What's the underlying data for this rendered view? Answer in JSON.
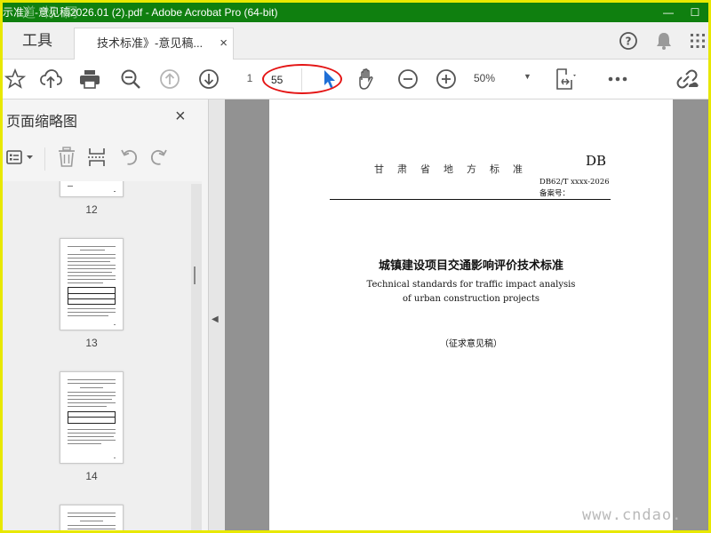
{
  "window": {
    "title": "示准》-意见稿2026.01 (2).pdf - Adobe Acrobat Pro (64-bit)",
    "watermark_top": "道 标 网",
    "minimize": "—",
    "maximize": "☐"
  },
  "tabs": {
    "tools": "工具",
    "document": "技术标准》-意见稿...",
    "close": "×"
  },
  "toolbar": {
    "page_current": "1",
    "page_total": "55",
    "zoom": "50%"
  },
  "thumbnail_panel": {
    "title": "页面缩略图",
    "close": "×",
    "pages": [
      {
        "label": "12"
      },
      {
        "label": "13"
      },
      {
        "label": "14"
      }
    ]
  },
  "document_page": {
    "header": "甘肃省地方标准",
    "category_mark": "DB",
    "standard_code": "DB62/T xxxx-2026",
    "record_number_label": "备案号：",
    "title_cn": "城镇建设项目交通影响评价技术标准",
    "title_en_line1": "Technical standards for traffic impact analysis",
    "title_en_line2": "of urban construction projects",
    "draft_label": "（征求意见稿）"
  },
  "watermark_bottom": "www.cndao.",
  "colors": {
    "titlebar": "#0f7f0f",
    "frame": "#e8e800",
    "annotation_ellipse": "#e41515",
    "cursor": "#1f6fd6",
    "doc_background": "#929292"
  }
}
